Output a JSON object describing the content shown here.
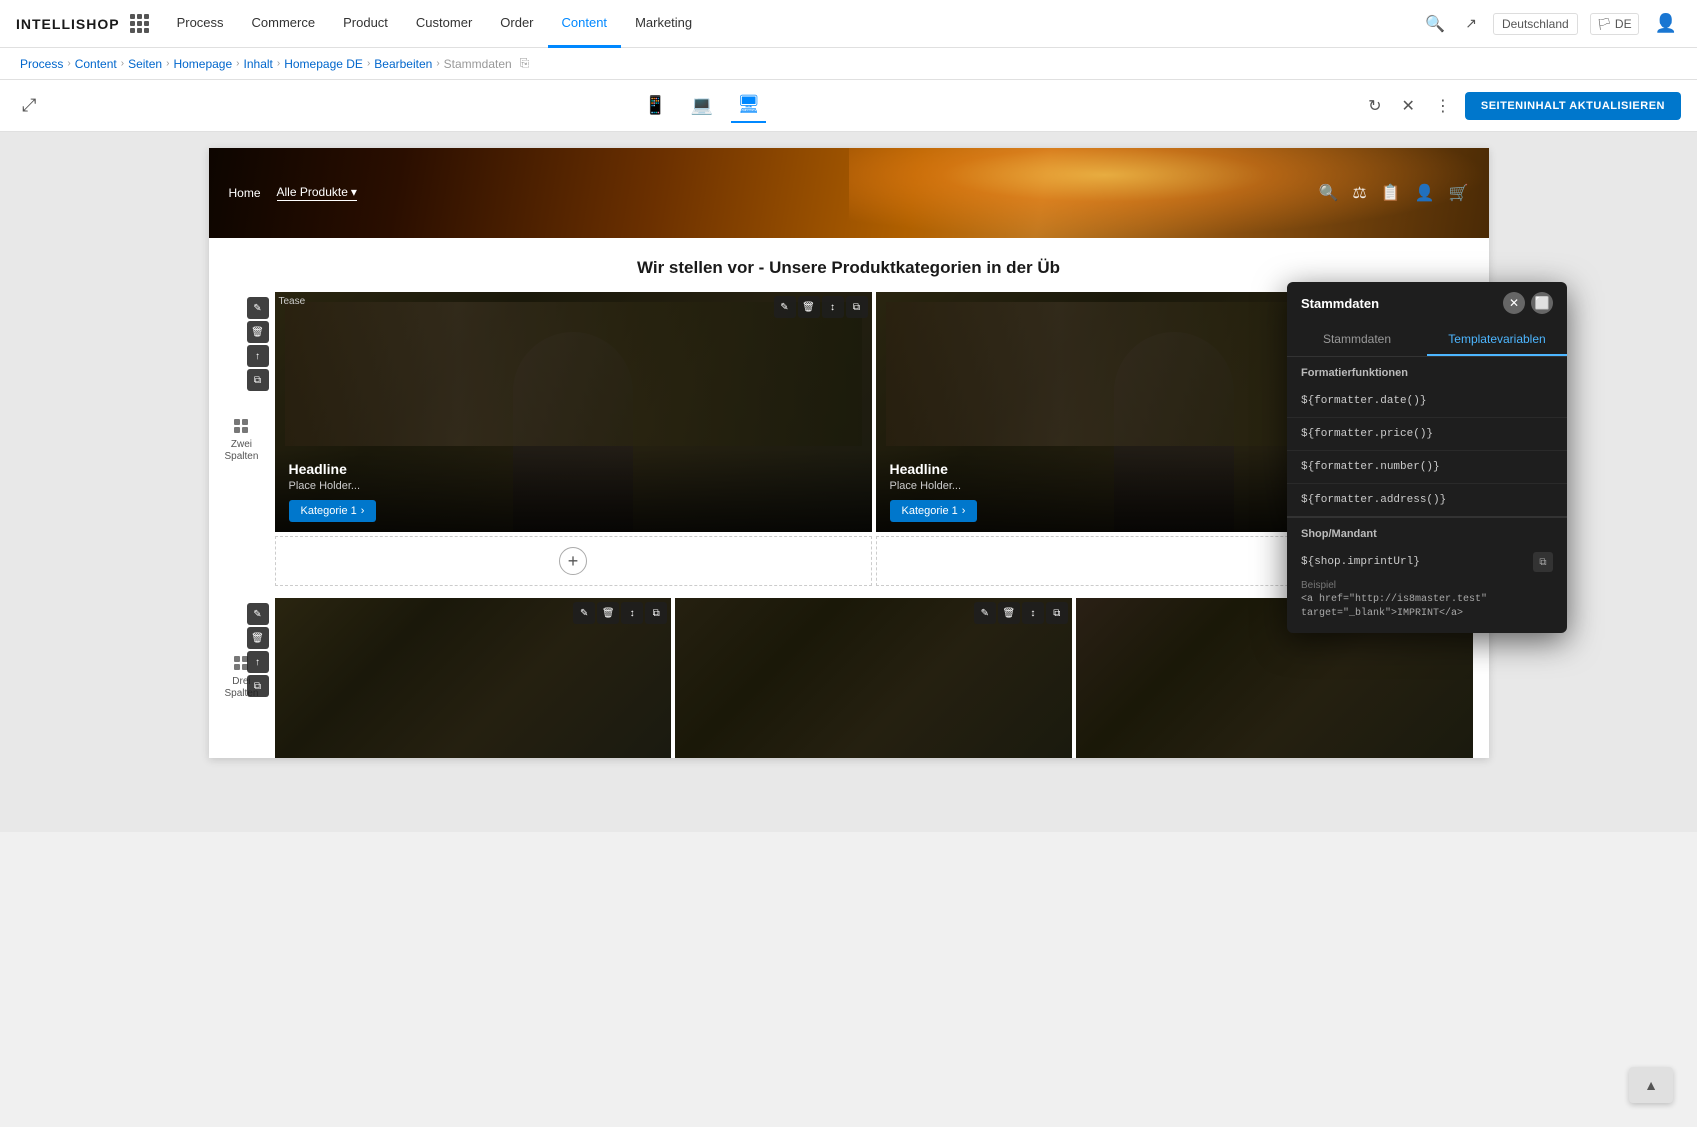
{
  "app": {
    "logo": "INTELLISHOP"
  },
  "topnav": {
    "items": [
      {
        "label": "Process",
        "active": false
      },
      {
        "label": "Commerce",
        "active": false
      },
      {
        "label": "Product",
        "active": false
      },
      {
        "label": "Customer",
        "active": false
      },
      {
        "label": "Order",
        "active": false
      },
      {
        "label": "Content",
        "active": true
      },
      {
        "label": "Marketing",
        "active": false
      }
    ],
    "lang": "Deutschland",
    "lang_code": "DE"
  },
  "breadcrumb": {
    "items": [
      {
        "label": "Process",
        "link": true
      },
      {
        "label": "Content",
        "link": true
      },
      {
        "label": "Seiten",
        "link": true
      },
      {
        "label": "Homepage",
        "link": true
      },
      {
        "label": "Inhalt",
        "link": true
      },
      {
        "label": "Homepage DE",
        "link": true
      },
      {
        "label": "Bearbeiten",
        "link": true
      },
      {
        "label": "Stammdaten",
        "link": false
      }
    ]
  },
  "toolbar": {
    "update_btn": "SEITENINHALT AKTUALISIEREN"
  },
  "hero": {
    "nav_home": "Home",
    "nav_products": "Alle Produkte"
  },
  "content": {
    "section_title": "Wir stellen vor - Unsere Produktkategorien in der Üb",
    "two_col_label": "Zwei\nSpalten",
    "three_col_label": "Drei\nSpalten",
    "card1_headline": "Headline",
    "card1_sub": "Place Holder...",
    "card1_btn": "Kategorie 1",
    "card2_headline": "Headline",
    "card2_sub": "Place Holder...",
    "card2_btn": "Kategorie 1"
  },
  "popup": {
    "title": "Stammdaten",
    "tab_template": "Templatevariablen",
    "tab_stamm": "Stammdaten",
    "section_format": "Formatierfunktionen",
    "formatter_date": "${formatter.date()}",
    "formatter_price": "${formatter.price()}",
    "formatter_number": "${formatter.number()}",
    "formatter_address": "${formatter.address()}",
    "section_shop": "Shop/Mandant",
    "shop_imprint": "${shop.imprintUrl}",
    "example_label": "Beispiel",
    "example_code": "<a href=\"http://is8master.test\"\ntarget=\"_blank\">IMPRINT</a>"
  },
  "scroll_btn_label": "▲"
}
